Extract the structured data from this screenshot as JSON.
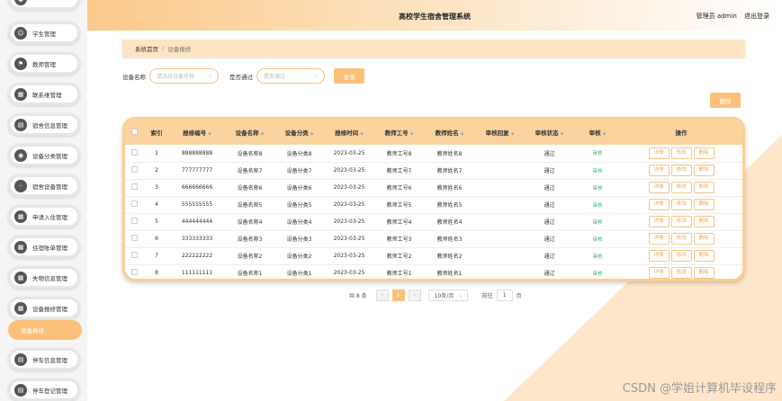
{
  "header": {
    "title": "高校学生宿舍管理系统",
    "user": "管理员 admin",
    "logout": "退出登录"
  },
  "sidebar": {
    "items": [
      {
        "label": "学生管理"
      },
      {
        "label": "教师管理"
      },
      {
        "label": "联系维管理"
      },
      {
        "label": "宿舍信息管理"
      },
      {
        "label": "设备分类管理"
      },
      {
        "label": "宿舍设备管理"
      },
      {
        "label": "申请入住管理"
      },
      {
        "label": "住宿账单管理"
      },
      {
        "label": "失物信息管理"
      },
      {
        "label": "设备报修管理"
      },
      {
        "label": "停车信息管理"
      },
      {
        "label": "停车登记管理"
      }
    ],
    "active_sub": "设备报修"
  },
  "breadcrumb": {
    "home": "系统首页",
    "separator": "/",
    "current": "设备报修"
  },
  "search": {
    "device_label": "设备名称",
    "device_placeholder": "请选择设备名称",
    "pass_label": "是否通过",
    "pass_placeholder": "是否通过",
    "query_button": "查询"
  },
  "toolbar": {
    "delete_button": "删除"
  },
  "table": {
    "columns": [
      "索引",
      "报修编号",
      "设备名称",
      "设备分类",
      "报修时间",
      "教师工号",
      "教师姓名",
      "审核回复",
      "审核状态",
      "审核",
      "操作"
    ],
    "rows": [
      {
        "index": "1",
        "no": "888888888",
        "name": "设备名称8",
        "cat": "设备分类8",
        "time": "2023-03-25",
        "tid": "教师工号8",
        "tname": "教师姓名8",
        "reply": "",
        "status": "通过",
        "audit": "审核"
      },
      {
        "index": "2",
        "no": "777777777",
        "name": "设备名称7",
        "cat": "设备分类7",
        "time": "2023-03-25",
        "tid": "教师工号7",
        "tname": "教师姓名7",
        "reply": "",
        "status": "通过",
        "audit": "审核"
      },
      {
        "index": "3",
        "no": "666666666",
        "name": "设备名称6",
        "cat": "设备分类6",
        "time": "2023-03-25",
        "tid": "教师工号6",
        "tname": "教师姓名6",
        "reply": "",
        "status": "通过",
        "audit": "审核"
      },
      {
        "index": "4",
        "no": "555555555",
        "name": "设备名称5",
        "cat": "设备分类5",
        "time": "2023-03-25",
        "tid": "教师工号5",
        "tname": "教师姓名5",
        "reply": "",
        "status": "通过",
        "audit": "审核"
      },
      {
        "index": "5",
        "no": "444444444",
        "name": "设备名称4",
        "cat": "设备分类4",
        "time": "2023-03-25",
        "tid": "教师工号4",
        "tname": "教师姓名4",
        "reply": "",
        "status": "通过",
        "audit": "审核"
      },
      {
        "index": "6",
        "no": "333333333",
        "name": "设备名称3",
        "cat": "设备分类3",
        "time": "2023-03-25",
        "tid": "教师工号3",
        "tname": "教师姓名3",
        "reply": "",
        "status": "通过",
        "audit": "审核"
      },
      {
        "index": "7",
        "no": "222222222",
        "name": "设备名称2",
        "cat": "设备分类2",
        "time": "2023-03-25",
        "tid": "教师工号2",
        "tname": "教师姓名2",
        "reply": "",
        "status": "通过",
        "audit": "审核"
      },
      {
        "index": "8",
        "no": "111111111",
        "name": "设备名称1",
        "cat": "设备分类1",
        "time": "2023-03-25",
        "tid": "教师工号1",
        "tname": "教师姓名1",
        "reply": "",
        "status": "通过",
        "audit": "审核"
      }
    ],
    "actions": [
      "详情",
      "修改",
      "删除"
    ]
  },
  "pagination": {
    "total": "共 8 条",
    "prev": "‹",
    "current": "1",
    "next": "›",
    "page_size": "10条/页",
    "goto_label": "前往",
    "goto_value": "1",
    "page_unit": "页"
  },
  "watermark": "CSDN @学姐计算机毕设程序",
  "colors": {
    "accent": "#fbc17a",
    "header_row": "#fbd39e",
    "breadcrumb_bg": "#fde4c3",
    "audit_green": "#3cb371"
  }
}
